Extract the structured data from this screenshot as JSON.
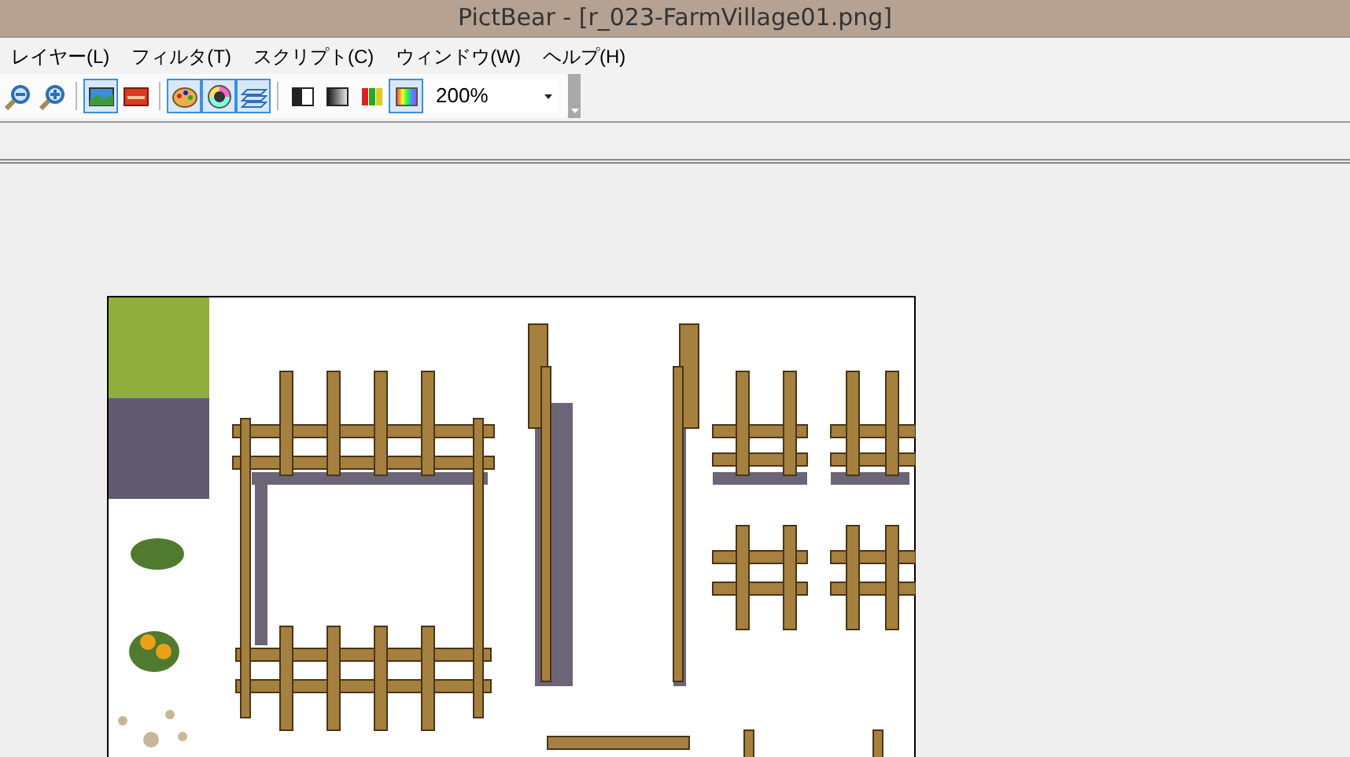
{
  "window": {
    "title": "PictBear - [r_023-FarmVillage01.png]"
  },
  "menu": [
    "レイヤー(L)",
    "フィルタ(T)",
    "スクリプト(C)",
    "ウィンドウ(W)",
    "ヘルプ(H)"
  ],
  "toolbar": {
    "groups": [
      [
        {
          "kind": "zoom-out",
          "selected": false
        },
        {
          "kind": "zoom-in",
          "selected": false
        }
      ],
      [
        {
          "kind": "image",
          "selected": true
        },
        {
          "kind": "red-card",
          "selected": false
        }
      ],
      [
        {
          "kind": "palette",
          "selected": true
        },
        {
          "kind": "color-wheel",
          "selected": true
        },
        {
          "kind": "layers",
          "selected": true
        }
      ],
      [
        {
          "kind": "half-tone",
          "selected": false
        },
        {
          "kind": "gradient",
          "selected": false
        },
        {
          "kind": "bars",
          "selected": false
        },
        {
          "kind": "spectrum",
          "selected": true
        }
      ]
    ],
    "zoom": {
      "value": "200%"
    }
  }
}
